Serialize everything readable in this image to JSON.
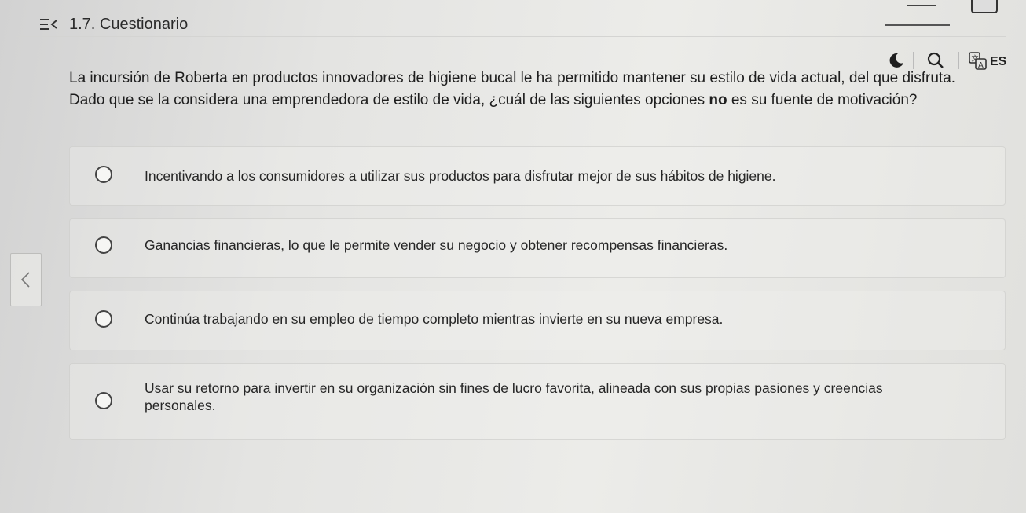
{
  "header": {
    "menu_icon": "menu-collapse-icon",
    "section_title": "1.7. Cuestionario"
  },
  "toolbar": {
    "theme_icon": "moon-icon",
    "search_icon": "search-icon",
    "translate_icon": "translate-icon",
    "language": "ES"
  },
  "question": {
    "line1": "La incursión de Roberta en productos innovadores de higiene bucal le ha permitido mantener su estilo de vida actual, del que disfruta.",
    "line2_before": "Dado que se la considera una emprendedora de estilo de vida, ¿cuál de las siguientes opciones ",
    "line2_emphasis": "no",
    "line2_after": " es su fuente de motivación?"
  },
  "options": [
    {
      "label": "Incentivando a los consumidores a utilizar sus productos para disfrutar mejor de sus hábitos de higiene.",
      "selected": false
    },
    {
      "label": "Ganancias financieras, lo que le permite vender su negocio y obtener recompensas financieras.",
      "selected": false
    },
    {
      "label": "Continúa trabajando en su empleo de tiempo completo mientras invierte en su nueva empresa.",
      "selected": false
    },
    {
      "label": "Usar su retorno para invertir en su organización sin fines de lucro favorita, alineada con sus propias pasiones y creencias personales.",
      "selected": false
    }
  ],
  "navigation": {
    "prev_icon": "chevron-left-icon"
  }
}
